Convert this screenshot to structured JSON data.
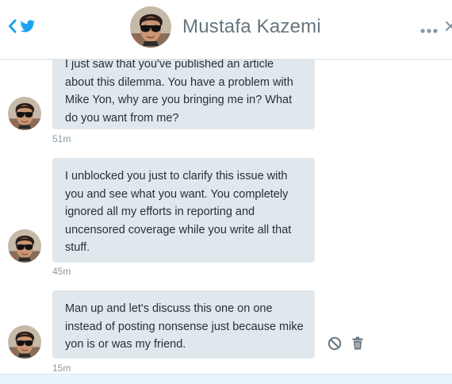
{
  "header": {
    "contact_name": "Mustafa Kazemi",
    "back_icon": "chevron-left-icon",
    "brand_icon": "twitter-bird-icon",
    "more_icon": "more-horizontal-icon",
    "close_icon": "close-icon"
  },
  "messages": [
    {
      "text": "I just saw that you've published an article about this dilemma. You have a problem with Mike Yon, why are you bringing me in? What do you want from me?",
      "time": "51m"
    },
    {
      "text": "I unblocked you just to clarify this issue with you and see what you want. You completely ignored all my efforts in reporting and uncensored coverage while you write all that stuff.",
      "time": "45m"
    },
    {
      "text": "Man up and let's discuss this one on one instead of posting nonsense just because mike yon is or was my friend.",
      "time": "15m",
      "actions": [
        "block-icon",
        "trash-icon"
      ]
    }
  ],
  "colors": {
    "accent": "#1da1f2",
    "bubble": "#e1e8ed",
    "name": "#66757f",
    "timestamp": "#8899a6",
    "text": "#292f33"
  }
}
